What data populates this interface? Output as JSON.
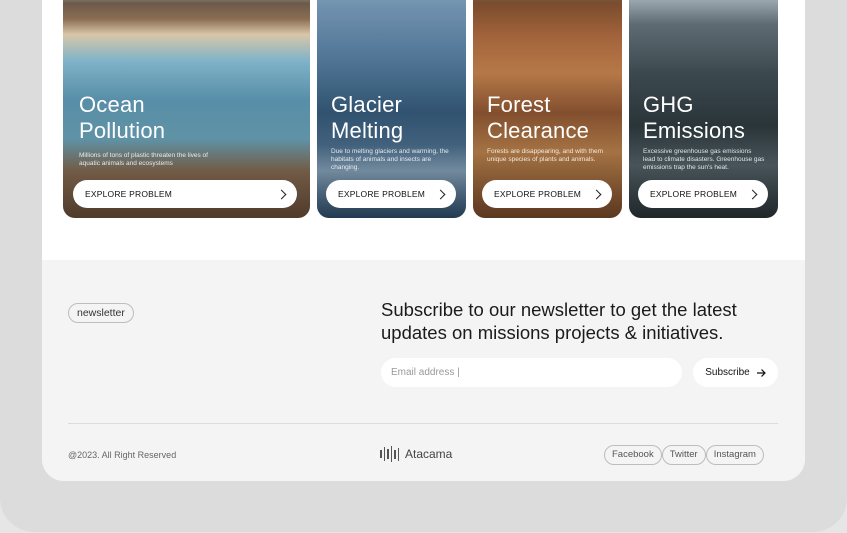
{
  "cards": [
    {
      "title_line1": "Ocean",
      "title_line2": "Pollution",
      "description": "Millions of tons of plastic threaten the lives of aquatic animals and ecosystems",
      "cta": "EXPLORE PROBLEM"
    },
    {
      "title_line1": "Glacier",
      "title_line2": "Melting",
      "description": "Due to melting glaciers and warming, the habitats of animals and insects are changing.",
      "cta": "EXPLORE PROBLEM"
    },
    {
      "title_line1": "Forest",
      "title_line2": "Clearance",
      "description": "Forests are disappearing, and with them unique species of plants and animals.",
      "cta": "EXPLORE PROBLEM"
    },
    {
      "title_line1": "GHG",
      "title_line2": "Emissions",
      "description": "Excessive greenhouse gas emissions lead to climate disasters. Greenhouse gas emissions trap the sun's heat.",
      "cta": "EXPLORE PROBLEM"
    }
  ],
  "newsletter": {
    "tag": "newsletter",
    "headline": "Subscribe to our newsletter to get the latest updates on missions projects & initiatives.",
    "email_placeholder": "Email address |",
    "subscribe_label": "Subscribe"
  },
  "footer": {
    "copyright": "@2023. All Right Reserved",
    "brand": "Atacama",
    "socials": [
      "Facebook",
      "Twitter",
      "Instagram"
    ]
  }
}
